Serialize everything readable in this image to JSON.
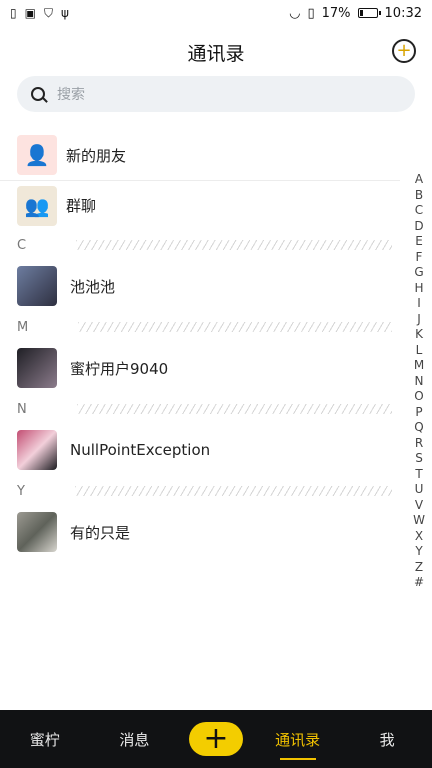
{
  "status_bar": {
    "battery": "17%",
    "time": "10:32",
    "battery_level": 0.17
  },
  "header": {
    "title": "通讯录",
    "add_icon": "plus-circle-icon"
  },
  "search": {
    "placeholder": "搜索"
  },
  "fixed_items": [
    {
      "label": "新的朋友",
      "icon": "add-user-icon"
    },
    {
      "label": "群聊",
      "icon": "group-chat-icon"
    }
  ],
  "sections": [
    {
      "letter": "C",
      "contacts": [
        {
          "name": "池池池"
        }
      ]
    },
    {
      "letter": "M",
      "contacts": [
        {
          "name": "蜜柠用户9040"
        }
      ]
    },
    {
      "letter": "N",
      "contacts": [
        {
          "name": "NullPointException"
        }
      ]
    },
    {
      "letter": "Y",
      "contacts": [
        {
          "name": "有的只是"
        }
      ]
    }
  ],
  "index_letters": [
    "A",
    "B",
    "C",
    "D",
    "E",
    "F",
    "G",
    "H",
    "I",
    "J",
    "K",
    "L",
    "M",
    "N",
    "O",
    "P",
    "Q",
    "R",
    "S",
    "T",
    "U",
    "V",
    "W",
    "X",
    "Y",
    "Z",
    "#"
  ],
  "bottom_nav": [
    {
      "label": "蜜柠"
    },
    {
      "label": "消息"
    },
    {
      "label": "+"
    },
    {
      "label": "通讯录"
    },
    {
      "label": "我"
    }
  ]
}
